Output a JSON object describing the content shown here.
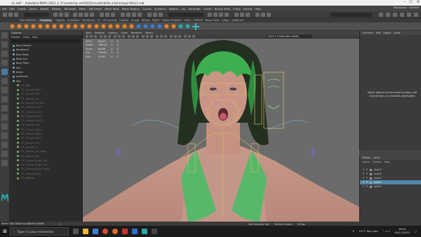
{
  "window": {
    "title": "v1.mb* - Autodesk MAYA 2022.3: E:\\model by zell\\2022\\model\\billie eilish\\maya file\\v1.mb",
    "controls": [
      "–",
      "☐",
      "✕"
    ]
  },
  "menubar": {
    "items": [
      "File",
      "Edit",
      "Create",
      "Select",
      "Modify",
      "Display",
      "Windows",
      "Mesh",
      "Edit Mesh",
      "Mesh Tools",
      "Mesh Display",
      "Curves",
      "Surfaces",
      "Deform",
      "UV",
      "Generate",
      "Cache",
      "Bonus Tools",
      "V-Ray",
      "Arnold",
      "Help"
    ],
    "workspace": "Workspace : General"
  },
  "shelf": {
    "tabs": [
      "Poly Modeling",
      "Sculpting",
      "Rigging",
      "Animation",
      "Rendering",
      "FX",
      "FX Caching",
      "Custom",
      "Arnold",
      "Bifrost",
      "MASH",
      "Motion Graphics",
      "XGen",
      "TURTLE",
      "Bonus Tools",
      "V-Ray",
      "GoZBrush"
    ],
    "active_tab": "Sculpting"
  },
  "outliner": {
    "title": "Outliner",
    "menu": [
      "Display",
      "Show",
      "Help"
    ],
    "items": [
      {
        "label": "Base_Tongue",
        "dim": false
      },
      {
        "label": "BaseBody1",
        "dim": false
      },
      {
        "label": "Base_Body",
        "dim": false
      },
      {
        "label": "Base_Eye",
        "dim": false
      },
      {
        "label": "Base_Teeth",
        "dim": false
      },
      {
        "label": "hair",
        "dim": false
      },
      {
        "label": "brows",
        "dim": false
      },
      {
        "label": "eyelashes",
        "dim": false
      },
      {
        "label": "Hair",
        "dim": false
      },
      {
        "label": "CTL_Jaw",
        "dim": true
      },
      {
        "label": "CTL_Tongue_Base",
        "dim": true
      },
      {
        "label": "CTL_Tongue_Mid",
        "dim": true
      },
      {
        "label": "CTL_Tongue_Tip",
        "dim": true
      },
      {
        "label": "CTL_Tongue_Up_Roll",
        "dim": true
      },
      {
        "label": "CTL_Tongue_Curl_L",
        "dim": true
      },
      {
        "label": "CTL_Tongue_Curl_R",
        "dim": true
      },
      {
        "label": "CTL_Tongue_Side_L",
        "dim": true
      },
      {
        "label": "CTL_Tongue_Side_R",
        "dim": true
      },
      {
        "label": "CTL_Tongue_Left",
        "dim": true
      },
      {
        "label": "CTL_Tongue_Right",
        "dim": true
      },
      {
        "label": "CTL_Tongue_Width",
        "dim": true
      },
      {
        "label": "CTL_Tongue_Twist",
        "dim": true
      },
      {
        "label": "CTL_Tongue_Out",
        "dim": true
      },
      {
        "label": "CTL_Tongue_In",
        "dim": true
      },
      {
        "label": "CTL_Tongue_Up_Down",
        "dim": true
      },
      {
        "label": "CTL_Tongue_Roll",
        "dim": true
      },
      {
        "label": "CTL_Tongue_Bulge_Out",
        "dim": true
      },
      {
        "label": "CTL_Tongue_Bulge_Left",
        "dim": true
      },
      {
        "label": "CTL_Tongue_Bulge_Right",
        "dim": true
      },
      {
        "label": "CTL_Tongue_Press",
        "dim": true
      },
      {
        "label": "CTL_Wrinkle",
        "dim": true
      }
    ]
  },
  "viewport": {
    "menu": [
      "View",
      "Shading",
      "Lighting",
      "Show",
      "Renderer",
      "Panels"
    ],
    "hud": [
      {
        "label": "Verts:",
        "v1": "84003",
        "v2": "0",
        "v3": "0"
      },
      {
        "label": "Edges:",
        "v1": "168113",
        "v2": "0",
        "v3": "0"
      },
      {
        "label": "Faces:",
        "v1": "84168",
        "v2": "0",
        "v3": "0"
      },
      {
        "label": "Tris:",
        "v1": "168224",
        "v2": "0",
        "v3": "0"
      },
      {
        "label": "UVs:",
        "v1": "97945",
        "v2": "0",
        "v3": "0"
      }
    ],
    "color_space": "ACES 1.0 SDR-video (sRGB)"
  },
  "channel_box": {
    "tabs": [
      "Channels",
      "Edit",
      "Object",
      "Show"
    ],
    "message": "Select objects to the scene to view, edit and set keys on channels (attributes)"
  },
  "layers": {
    "tabs": [
      "Display",
      "Anim"
    ],
    "menu": [
      "Layers",
      "Options",
      "Help"
    ],
    "rows": [
      {
        "v": "V",
        "p": "P",
        "name": "layer3",
        "selected": false
      },
      {
        "v": "V",
        "p": "P",
        "name": "layer4",
        "selected": false
      },
      {
        "v": "V",
        "p": "P",
        "name": "layer2",
        "selected": false
      },
      {
        "v": "V",
        "p": "P",
        "name": "layer1",
        "selected": true
      },
      {
        "v": "V",
        "p": "P",
        "name": "layer5",
        "selected": false
      }
    ]
  },
  "timeline": {
    "frame": "1",
    "char_set": "No Character Set",
    "anim_layer": "No Anim Layer",
    "fps": "24 fps"
  },
  "help_line": "Rotate Tool: Select an object to rotate.",
  "taskbar": {
    "search_placeholder": "Taper ici pour rechercher",
    "weather": "10°C Très clair",
    "time": "08:41",
    "date": "09/11/2022"
  }
}
